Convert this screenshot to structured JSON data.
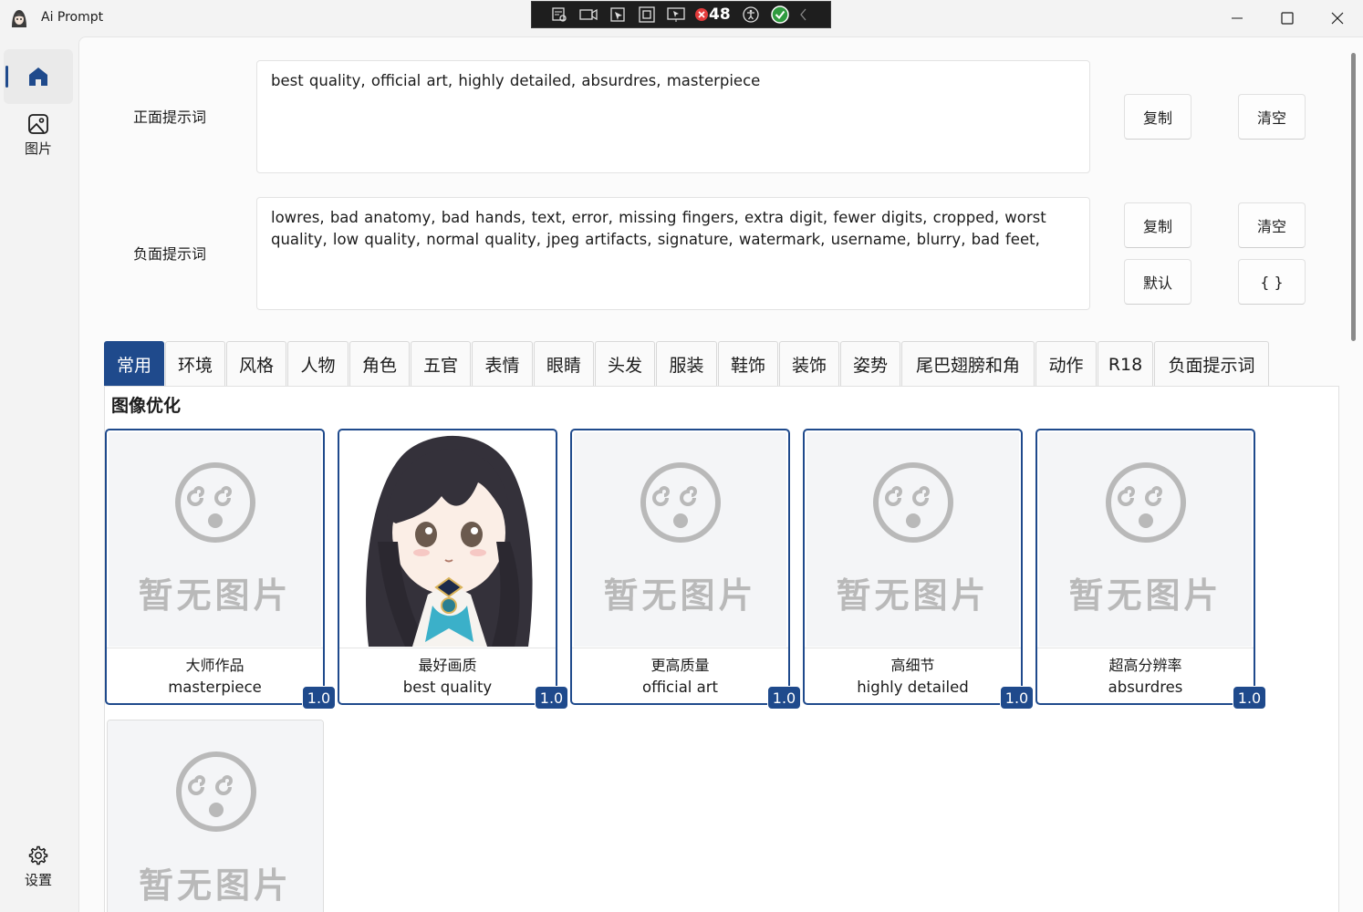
{
  "window": {
    "title": "Ai Prompt",
    "controls": {
      "minimize": "minimize",
      "maximize": "maximize",
      "close": "close"
    }
  },
  "debug_toolbar": {
    "counter": "48"
  },
  "nav": {
    "home_label": "",
    "images_label": "图片",
    "settings_label": "设置"
  },
  "prompts": {
    "positive": {
      "label": "正面提示词",
      "value": "best quality, official art, highly detailed, absurdres, masterpiece",
      "copy_label": "复制",
      "clear_label": "清空"
    },
    "negative": {
      "label": "负面提示词",
      "value": "lowres, bad anatomy, bad hands, text, error, missing fingers, extra digit, fewer digits, cropped, worst quality, low quality, normal quality, jpeg artifacts, signature, watermark, username, blurry, bad feet,",
      "copy_label": "复制",
      "clear_label": "清空",
      "default_label": "默认",
      "braces_label": "{ }"
    }
  },
  "tabs": [
    "常用",
    "环境",
    "风格",
    "人物",
    "角色",
    "五官",
    "表情",
    "眼睛",
    "头发",
    "服装",
    "鞋饰",
    "装饰",
    "姿势",
    "尾巴翅膀和角",
    "动作",
    "R18",
    "负面提示词"
  ],
  "active_tab": "常用",
  "section": {
    "title": "图像优化",
    "placeholder_text": "暂无图片",
    "cards": [
      {
        "cn": "大师作品",
        "en": "masterpiece",
        "weight": "1.0",
        "has_image": false
      },
      {
        "cn": "最好画质",
        "en": "best quality",
        "weight": "1.0",
        "has_image": true
      },
      {
        "cn": "更高质量",
        "en": "official art",
        "weight": "1.0",
        "has_image": false
      },
      {
        "cn": "高细节",
        "en": "highly detailed",
        "weight": "1.0",
        "has_image": false
      },
      {
        "cn": "超高分辨率",
        "en": "absurdres",
        "weight": "1.0",
        "has_image": false
      }
    ]
  },
  "colors": {
    "accent": "#1f4a8c",
    "placeholder": "#b9b9b9"
  }
}
